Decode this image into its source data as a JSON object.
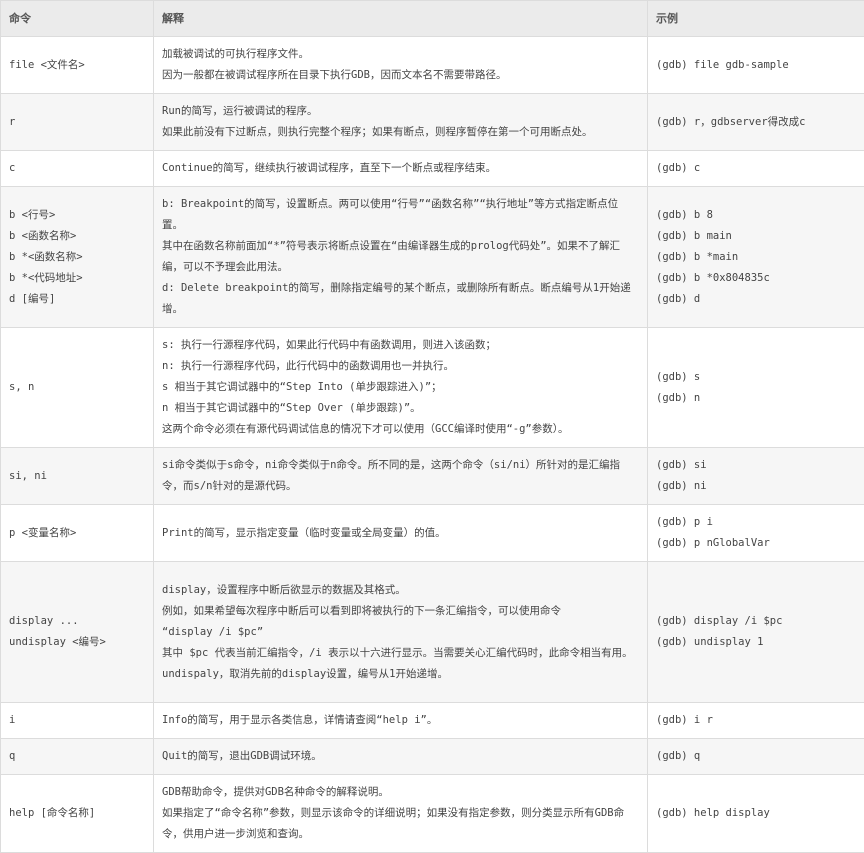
{
  "headers": {
    "command": "命令",
    "explanation": "解释",
    "example": "示例"
  },
  "rows": [
    {
      "command": [
        "file <文件名>"
      ],
      "explanation": [
        "加载被调试的可执行程序文件。",
        "因为一般都在被调试程序所在目录下执行GDB，因而文本名不需要带路径。"
      ],
      "example": [
        "(gdb) file gdb-sample"
      ]
    },
    {
      "command": [
        "r"
      ],
      "explanation": [
        "Run的简写，运行被调试的程序。",
        "如果此前没有下过断点，则执行完整个程序；如果有断点，则程序暂停在第一个可用断点处。"
      ],
      "example": [
        "(gdb) r，gdbserver得改成c"
      ]
    },
    {
      "command": [
        "c"
      ],
      "explanation": [
        "Continue的简写，继续执行被调试程序，直至下一个断点或程序结束。"
      ],
      "example": [
        "(gdb) c"
      ]
    },
    {
      "command": [
        "b <行号>",
        "b <函数名称>",
        "b *<函数名称>",
        "b *<代码地址>",
        "d [编号]"
      ],
      "explanation": [
        "b: Breakpoint的简写，设置断点。两可以使用“行号”“函数名称”“执行地址”等方式指定断点位置。",
        "其中在函数名称前面加“*”符号表示将断点设置在“由编译器生成的prolog代码处”。如果不了解汇编，可以不予理会此用法。",
        "d: Delete breakpoint的简写，删除指定编号的某个断点，或删除所有断点。断点编号从1开始递增。"
      ],
      "example": [
        "(gdb) b 8",
        "(gdb) b main",
        "(gdb) b *main",
        "(gdb) b *0x804835c",
        "(gdb) d"
      ]
    },
    {
      "command": [
        "s, n"
      ],
      "explanation": [
        "s: 执行一行源程序代码，如果此行代码中有函数调用，则进入该函数；",
        "n: 执行一行源程序代码，此行代码中的函数调用也一并执行。",
        "s 相当于其它调试器中的“Step Into (单步跟踪进入)”；",
        "n 相当于其它调试器中的“Step Over (单步跟踪)”。",
        "这两个命令必须在有源代码调试信息的情况下才可以使用（GCC编译时使用“-g”参数）。"
      ],
      "example": [
        "(gdb) s",
        "(gdb) n"
      ]
    },
    {
      "command": [
        "si, ni"
      ],
      "explanation": [
        "si命令类似于s命令，ni命令类似于n命令。所不同的是，这两个命令（si/ni）所针对的是汇编指令，而s/n针对的是源代码。"
      ],
      "example": [
        "(gdb) si",
        "(gdb) ni"
      ]
    },
    {
      "command": [
        "p <变量名称>"
      ],
      "explanation": [
        "Print的简写，显示指定变量（临时变量或全局变量）的值。"
      ],
      "example": [
        "(gdb) p i",
        "(gdb) p nGlobalVar"
      ]
    },
    {
      "command": [
        "display ...",
        "undisplay <编号>"
      ],
      "explanation": [
        "display，设置程序中断后欲显示的数据及其格式。",
        "例如，如果希望每次程序中断后可以看到即将被执行的下一条汇编指令，可以使用命令",
        "“display /i $pc”",
        "其中 $pc 代表当前汇编指令，/i 表示以十六进行显示。当需要关心汇编代码时，此命令相当有用。",
        "undispaly，取消先前的display设置，编号从1开始递增。"
      ],
      "example": [
        "(gdb) display /i $pc",
        "(gdb) undisplay 1"
      ]
    },
    {
      "command": [
        "i"
      ],
      "explanation": [
        "Info的简写，用于显示各类信息，详情请查阅“help i”。"
      ],
      "example": [
        "(gdb) i r"
      ]
    },
    {
      "command": [
        "q"
      ],
      "explanation": [
        "Quit的简写，退出GDB调试环境。"
      ],
      "example": [
        "(gdb) q"
      ]
    },
    {
      "command": [
        "help [命令名称]"
      ],
      "explanation": [
        "GDB帮助命令，提供对GDB名种命令的解释说明。",
        "如果指定了“命令名称”参数，则显示该命令的详细说明；如果没有指定参数，则分类显示所有GDB命令，供用户进一步浏览和查询。"
      ],
      "example": [
        "(gdb) help display"
      ]
    }
  ]
}
